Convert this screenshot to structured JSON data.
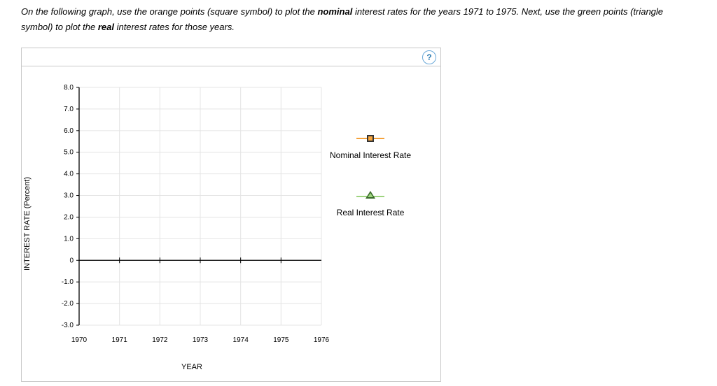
{
  "instruction": {
    "pre": "On the following graph, use the orange points (square symbol) to plot the ",
    "bold1": "nominal",
    "mid": " interest rates for the years 1971 to 1975. Next, use the green points (triangle symbol) to plot the ",
    "bold2": "real",
    "post": " interest rates for those years."
  },
  "toolbar": {
    "help": "?"
  },
  "legend": {
    "nominal": "Nominal Interest Rate",
    "real": "Real Interest Rate"
  },
  "axes": {
    "xlabel": "YEAR",
    "ylabel": "INTEREST RATE (Percent)"
  },
  "chart_data": {
    "type": "scatter",
    "title": "",
    "xlabel": "YEAR",
    "ylabel": "INTEREST RATE (Percent)",
    "x_ticks": [
      "1970",
      "1971",
      "1972",
      "1973",
      "1974",
      "1975",
      "1976"
    ],
    "y_ticks": [
      "8.0",
      "7.0",
      "6.0",
      "5.0",
      "4.0",
      "3.0",
      "2.0",
      "1.0",
      "0",
      "-1.0",
      "-2.0",
      "-3.0"
    ],
    "xlim": [
      1970,
      1976
    ],
    "ylim": [
      -3.0,
      8.0
    ],
    "grid": true,
    "series": [
      {
        "name": "Nominal Interest Rate",
        "symbol": "square",
        "color": "#f5a23a",
        "x": [],
        "values": []
      },
      {
        "name": "Real Interest Rate",
        "symbol": "triangle",
        "color": "#9ed47f",
        "x": [],
        "values": []
      }
    ]
  }
}
